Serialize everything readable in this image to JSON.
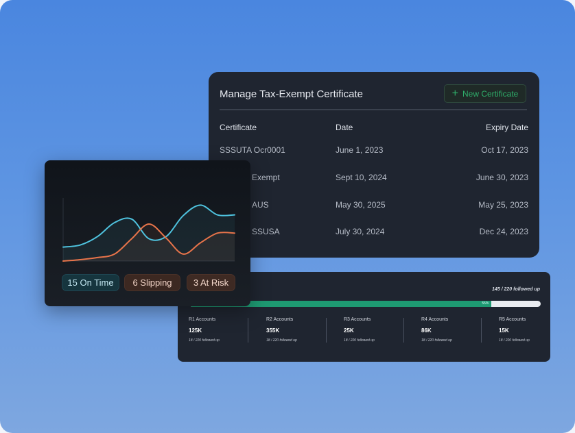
{
  "certificates": {
    "title": "Manage Tax-Exempt Certificate",
    "new_button": "New Certificate",
    "headers": {
      "certificate": "Certificate",
      "date": "Date",
      "expiry": "Expiry Date"
    },
    "rows": [
      {
        "name": "SSSUTA Ocr0001",
        "date": "June 1, 2023",
        "expiry": "Oct 17, 2023"
      },
      {
        "name": "Exempt",
        "date": "Sept 10, 2024",
        "expiry": "June 30, 2023"
      },
      {
        "name": "AUS",
        "date": "May 30, 2025",
        "expiry": "May 25, 2023"
      },
      {
        "name": "SSUSA",
        "date": "July 30, 2024",
        "expiry": "Dec 24, 2023"
      }
    ]
  },
  "followup": {
    "summary": "145 / 220 followed up",
    "percent_label": "55%",
    "progress": 0.86,
    "accounts": [
      {
        "name": "R1 Accounts",
        "value": "125K",
        "sub": "18 / 220 followed up"
      },
      {
        "name": "R2 Accounts",
        "value": "355K",
        "sub": "18 / 220 followed up"
      },
      {
        "name": "R3 Accounts",
        "value": "25K",
        "sub": "18 / 220 followed up"
      },
      {
        "name": "R4 Accounts",
        "value": "86K",
        "sub": "18 / 220 followed up"
      },
      {
        "name": "R5 Accounts",
        "value": "15K",
        "sub": "18 / 220 followed up"
      }
    ]
  },
  "status_chart": {
    "chips": {
      "on_time": "15 On Time",
      "slipping": "6 Slipping",
      "at_risk": "3 At Risk"
    },
    "colors": {
      "on_time": "#4fc3df",
      "slipping": "#e8744a"
    }
  },
  "chart_data": {
    "type": "line",
    "x": [
      0,
      1,
      2,
      3,
      4,
      5,
      6,
      7,
      8,
      9,
      10
    ],
    "series": [
      {
        "values": [
          2,
          2.3,
          3.5,
          5.5,
          6.0,
          3.2,
          3.5,
          6.5,
          8.0,
          6.6,
          6.6
        ]
      },
      {
        "values": [
          0,
          0.2,
          0.5,
          1.0,
          3.2,
          5.3,
          3.3,
          1.0,
          2.6,
          4.0,
          4.0
        ]
      }
    ],
    "ylim": [
      0,
      10
    ]
  }
}
